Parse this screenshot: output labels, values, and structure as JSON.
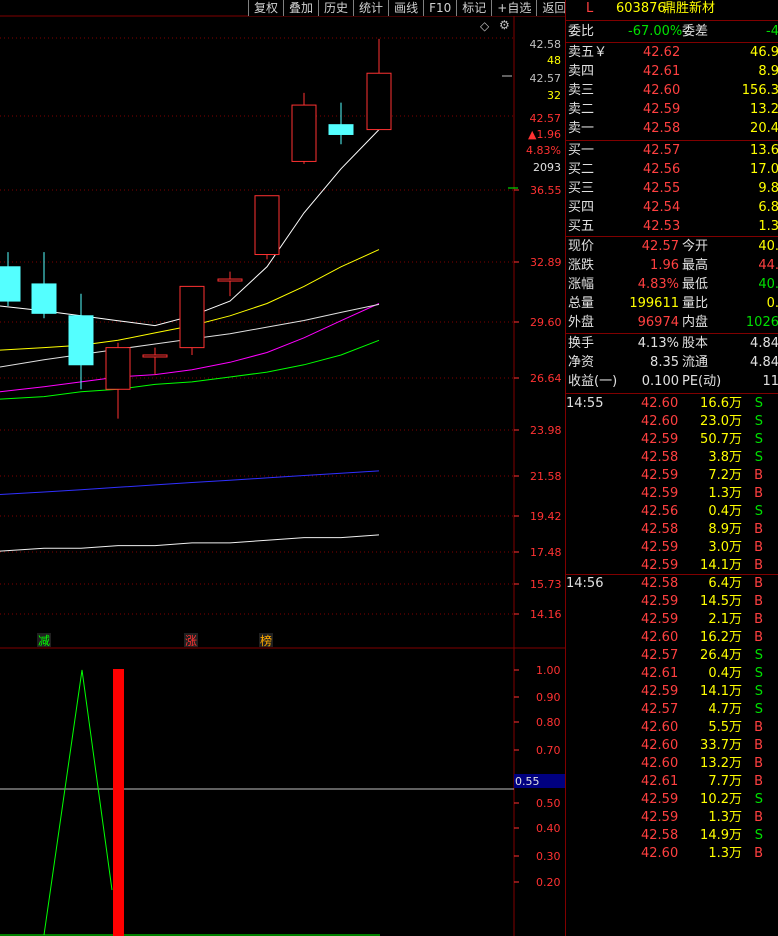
{
  "toolbar": [
    "复权",
    "叠加",
    "历史",
    "统计",
    "画线",
    "F10",
    "标记",
    "+自选",
    "返回"
  ],
  "colors": {
    "up": "#ff3232",
    "down": "#54ffff",
    "grid": "#800000",
    "ma5": "#ffffff",
    "ma10": "#ffff00",
    "ma20": "#ff00ff",
    "ma30": "#00ff00"
  },
  "price_axis": [
    "36.55",
    "32.89",
    "29.60",
    "26.64",
    "23.98",
    "21.58",
    "19.42",
    "17.48",
    "15.73",
    "14.16"
  ],
  "top_info": {
    "p1": "42.58",
    "v1": "48",
    "p2": "42.57",
    "v2": "32",
    "p3": "42.57",
    "chg": "▲1.96",
    "pct": "4.83%",
    "vol": "2093"
  },
  "signals": {
    "a": "减",
    "b": "涨",
    "c": "榜"
  },
  "ind_axis": [
    "1.00",
    "0.90",
    "0.80",
    "0.70",
    "0.55",
    "0.50",
    "0.40",
    "0.30",
    "0.20"
  ],
  "chart_data": {
    "type": "candlestick",
    "candles": [
      {
        "o": 34.6,
        "c": 33.2,
        "h": 35.2,
        "l": 33.0
      },
      {
        "o": 33.9,
        "c": 32.7,
        "h": 35.2,
        "l": 32.5
      },
      {
        "o": 32.6,
        "c": 30.6,
        "h": 33.5,
        "l": 29.6
      },
      {
        "o": 29.6,
        "c": 31.3,
        "h": 31.5,
        "l": 28.4
      },
      {
        "o": 31.0,
        "c": 31.0,
        "h": 31.3,
        "l": 30.2
      },
      {
        "o": 31.3,
        "c": 33.8,
        "h": 33.8,
        "l": 31.0
      },
      {
        "o": 34.1,
        "c": 34.1,
        "h": 34.4,
        "l": 33.4
      },
      {
        "o": 35.1,
        "c": 37.5,
        "h": 37.5,
        "l": 34.9
      },
      {
        "o": 38.9,
        "c": 41.2,
        "h": 41.7,
        "l": 38.8
      },
      {
        "o": 40.4,
        "c": 40.0,
        "h": 41.3,
        "l": 39.6
      },
      {
        "o": 40.2,
        "c": 42.5,
        "h": 43.9,
        "l": 40.2
      }
    ],
    "ma_series": [
      {
        "values": [
          33.0,
          32.8,
          32.6,
          32.4,
          32.2,
          32.6,
          33.2,
          34.6,
          36.8,
          38.6,
          40.2
        ]
      },
      {
        "values": [
          31.2,
          31.3,
          31.4,
          31.6,
          31.9,
          32.2,
          32.6,
          33.1,
          33.8,
          34.6,
          35.3
        ]
      },
      {
        "values": [
          29.5,
          29.7,
          29.9,
          30.1,
          30.2,
          30.4,
          30.7,
          31.1,
          31.7,
          32.4,
          33.1
        ]
      },
      {
        "values": [
          29.2,
          29.3,
          29.5,
          29.6,
          29.8,
          29.9,
          30.1,
          30.3,
          30.6,
          31.0,
          31.6
        ]
      },
      {
        "values": [
          24.6,
          25.0,
          25.3,
          25.6,
          25.9,
          26.2,
          26.5,
          26.9,
          27.3,
          27.8,
          28.3
        ]
      },
      {
        "values": [
          18.5,
          18.6,
          18.7,
          18.8,
          18.9,
          19.0,
          19.1,
          19.2,
          19.3,
          19.4,
          19.5
        ]
      },
      {
        "values": [
          16.3,
          16.4,
          16.4,
          16.5,
          16.5,
          16.6,
          16.6,
          16.7,
          16.8,
          16.8,
          16.9
        ]
      }
    ],
    "indicator_line": [
      0,
      0,
      0,
      1,
      0.15
    ],
    "indicator_bar": 1.0,
    "indicator_level": 0.55
  },
  "stock": {
    "mark": "L",
    "code": "603876",
    "name": "鼎胜新材"
  },
  "weibi": {
    "label": "委比",
    "value": "-67.00%",
    "label2": "委差",
    "value2": "-4"
  },
  "sells": [
    {
      "label": "卖五",
      "mark": "￥",
      "price": "42.62",
      "vol": "46.9"
    },
    {
      "label": "卖四",
      "mark": "",
      "price": "42.61",
      "vol": "8.9"
    },
    {
      "label": "卖三",
      "mark": "",
      "price": "42.60",
      "vol": "156.3"
    },
    {
      "label": "卖二",
      "mark": "",
      "price": "42.59",
      "vol": "13.2"
    },
    {
      "label": "卖一",
      "mark": "",
      "price": "42.58",
      "vol": "20.4"
    }
  ],
  "buys": [
    {
      "label": "买一",
      "price": "42.57",
      "vol": "13.6"
    },
    {
      "label": "买二",
      "price": "42.56",
      "vol": "17.0"
    },
    {
      "label": "买三",
      "price": "42.55",
      "vol": "9.8"
    },
    {
      "label": "买四",
      "price": "42.54",
      "vol": "6.8"
    },
    {
      "label": "买五",
      "price": "42.53",
      "vol": "1.3"
    }
  ],
  "quote": [
    {
      "l1": "现价",
      "v1": "42.57",
      "l2": "今开",
      "v2": "40."
    },
    {
      "l1": "涨跌",
      "v1": "1.96",
      "l2": "最高",
      "v2": "44."
    },
    {
      "l1": "涨幅",
      "v1": "4.83%",
      "l2": "最低",
      "v2": "40."
    },
    {
      "l1": "总量",
      "v1": "199611",
      "l2": "量比",
      "v2": "0."
    },
    {
      "l1": "外盘",
      "v1": "96974",
      "l2": "内盘",
      "v2": "1026"
    }
  ],
  "finance": [
    {
      "l1": "换手",
      "v1": "4.13%",
      "l2": "股本",
      "v2": "4.84"
    },
    {
      "l1": "净资",
      "v1": "8.35",
      "l2": "流通",
      "v2": "4.84"
    },
    {
      "l1": "收益(一)",
      "v1": "0.100",
      "l2": "PE(动)",
      "v2": "11"
    }
  ],
  "ticks": [
    {
      "time": "14:55",
      "price": "42.60",
      "vol": "16.6万",
      "side": "S"
    },
    {
      "time": "",
      "price": "42.60",
      "vol": "23.0万",
      "side": "S"
    },
    {
      "time": "",
      "price": "42.59",
      "vol": "50.7万",
      "side": "S"
    },
    {
      "time": "",
      "price": "42.58",
      "vol": "3.8万",
      "side": "S"
    },
    {
      "time": "",
      "price": "42.59",
      "vol": "7.2万",
      "side": "B"
    },
    {
      "time": "",
      "price": "42.59",
      "vol": "1.3万",
      "side": "B"
    },
    {
      "time": "",
      "price": "42.56",
      "vol": "0.4万",
      "side": "S"
    },
    {
      "time": "",
      "price": "42.58",
      "vol": "8.9万",
      "side": "B"
    },
    {
      "time": "",
      "price": "42.59",
      "vol": "3.0万",
      "side": "B"
    },
    {
      "time": "",
      "price": "42.59",
      "vol": "14.1万",
      "side": "B"
    },
    {
      "time": "14:56",
      "price": "42.58",
      "vol": "6.4万",
      "side": "B"
    },
    {
      "time": "",
      "price": "42.59",
      "vol": "14.5万",
      "side": "B"
    },
    {
      "time": "",
      "price": "42.59",
      "vol": "2.1万",
      "side": "B"
    },
    {
      "time": "",
      "price": "42.60",
      "vol": "16.2万",
      "side": "B"
    },
    {
      "time": "",
      "price": "42.57",
      "vol": "26.4万",
      "side": "S"
    },
    {
      "time": "",
      "price": "42.61",
      "vol": "0.4万",
      "side": "S"
    },
    {
      "time": "",
      "price": "42.59",
      "vol": "14.1万",
      "side": "S"
    },
    {
      "time": "",
      "price": "42.57",
      "vol": "4.7万",
      "side": "S"
    },
    {
      "time": "",
      "price": "42.60",
      "vol": "5.5万",
      "side": "B"
    },
    {
      "time": "",
      "price": "42.60",
      "vol": "33.7万",
      "side": "B"
    },
    {
      "time": "",
      "price": "42.60",
      "vol": "13.2万",
      "side": "B"
    },
    {
      "time": "",
      "price": "42.61",
      "vol": "7.7万",
      "side": "B"
    },
    {
      "time": "",
      "price": "42.59",
      "vol": "10.2万",
      "side": "S"
    },
    {
      "time": "",
      "price": "42.59",
      "vol": "1.3万",
      "side": "B"
    },
    {
      "time": "",
      "price": "42.58",
      "vol": "14.9万",
      "side": "S"
    },
    {
      "time": "",
      "price": "42.60",
      "vol": "1.3万",
      "side": "B"
    }
  ]
}
